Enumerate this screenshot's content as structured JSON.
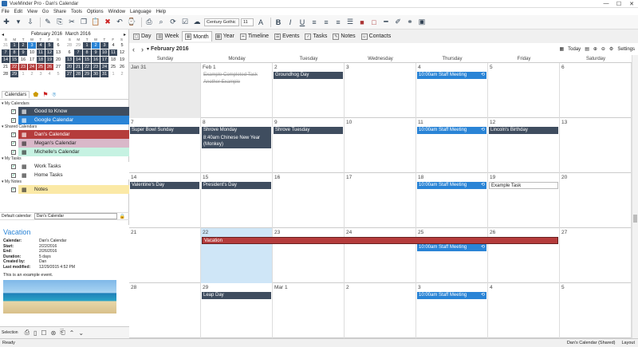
{
  "window": {
    "title": "VueMinder Pro - Dan's Calendar",
    "min": "—",
    "max": "☐",
    "close": "✕"
  },
  "menu": [
    "File",
    "Edit",
    "View",
    "Go",
    "Share",
    "Tools",
    "Options",
    "Window",
    "Language",
    "Help"
  ],
  "toolbar": {
    "font": "Century Gothic",
    "size": "11"
  },
  "mini_calendars": [
    {
      "month": "February 2016",
      "prev": "◂",
      "dow": [
        "S",
        "M",
        "T",
        "W",
        "T",
        "F",
        "S"
      ],
      "days": [
        {
          "n": "31",
          "s": "gr"
        },
        {
          "n": "1",
          "s": "dk"
        },
        {
          "n": "2",
          "s": "dk"
        },
        {
          "n": "3",
          "s": "bl"
        },
        {
          "n": "4",
          "s": "dk"
        },
        {
          "n": "5",
          "s": "dk"
        },
        {
          "n": "6",
          "s": ""
        },
        {
          "n": "7",
          "s": "dk"
        },
        {
          "n": "8",
          "s": "dk"
        },
        {
          "n": "9",
          "s": "dk"
        },
        {
          "n": "10",
          "s": ""
        },
        {
          "n": "11",
          "s": "dk"
        },
        {
          "n": "12",
          "s": "dk"
        },
        {
          "n": "13",
          "s": ""
        },
        {
          "n": "14",
          "s": "dk"
        },
        {
          "n": "15",
          "s": "dk"
        },
        {
          "n": "16",
          "s": ""
        },
        {
          "n": "17",
          "s": ""
        },
        {
          "n": "18",
          "s": "dk"
        },
        {
          "n": "19",
          "s": "dk"
        },
        {
          "n": "20",
          "s": ""
        },
        {
          "n": "21",
          "s": ""
        },
        {
          "n": "22",
          "s": "rd"
        },
        {
          "n": "23",
          "s": "rd"
        },
        {
          "n": "24",
          "s": "rd"
        },
        {
          "n": "25",
          "s": "rd"
        },
        {
          "n": "26",
          "s": "rd"
        },
        {
          "n": "27",
          "s": ""
        },
        {
          "n": "28",
          "s": ""
        },
        {
          "n": "29",
          "s": "dk"
        },
        {
          "n": "1",
          "s": "gr"
        },
        {
          "n": "2",
          "s": "gr"
        },
        {
          "n": "3",
          "s": "gr"
        },
        {
          "n": "4",
          "s": "gr"
        },
        {
          "n": "5",
          "s": "gr"
        }
      ]
    },
    {
      "month": "March 2016",
      "next": "▸",
      "dow": [
        "S",
        "M",
        "T",
        "W",
        "T",
        "F",
        "S"
      ],
      "days": [
        {
          "n": "28",
          "s": "gr"
        },
        {
          "n": "29",
          "s": "gr"
        },
        {
          "n": "1",
          "s": "dk"
        },
        {
          "n": "2",
          "s": "bl"
        },
        {
          "n": "3",
          "s": "dk"
        },
        {
          "n": "4",
          "s": ""
        },
        {
          "n": "5",
          "s": ""
        },
        {
          "n": "6",
          "s": ""
        },
        {
          "n": "7",
          "s": "dk"
        },
        {
          "n": "8",
          "s": "dk"
        },
        {
          "n": "9",
          "s": "dk"
        },
        {
          "n": "10",
          "s": "dk"
        },
        {
          "n": "11",
          "s": "dk"
        },
        {
          "n": "12",
          "s": ""
        },
        {
          "n": "13",
          "s": "dk"
        },
        {
          "n": "14",
          "s": "dk"
        },
        {
          "n": "15",
          "s": "dk"
        },
        {
          "n": "16",
          "s": "dk"
        },
        {
          "n": "17",
          "s": "dk"
        },
        {
          "n": "18",
          "s": ""
        },
        {
          "n": "19",
          "s": ""
        },
        {
          "n": "20",
          "s": "dk"
        },
        {
          "n": "21",
          "s": "dk"
        },
        {
          "n": "22",
          "s": "dk"
        },
        {
          "n": "23",
          "s": "dk"
        },
        {
          "n": "24",
          "s": "dk"
        },
        {
          "n": "25",
          "s": ""
        },
        {
          "n": "26",
          "s": ""
        },
        {
          "n": "27",
          "s": "dk"
        },
        {
          "n": "28",
          "s": "dk"
        },
        {
          "n": "29",
          "s": "dk"
        },
        {
          "n": "30",
          "s": "dk"
        },
        {
          "n": "31",
          "s": "dk"
        },
        {
          "n": "1",
          "s": "gr"
        },
        {
          "n": "2",
          "s": "gr"
        }
      ]
    }
  ],
  "left_tabs": {
    "calendars": "Calendars"
  },
  "calendar_groups": [
    {
      "name": "My Calendars",
      "items": [
        {
          "label": "Good to Know",
          "bg": "#3f4d5f",
          "fg": "#ffffff"
        },
        {
          "label": "Google Calendar",
          "bg": "#2a84d6",
          "fg": "#ffffff"
        }
      ]
    },
    {
      "name": "Shared Calendars",
      "items": [
        {
          "label": "Dan's Calendar",
          "bg": "#b53c3c",
          "fg": "#ffffff"
        },
        {
          "label": "Megan's Calendar",
          "bg": "#d9b8c9",
          "fg": "#222222"
        },
        {
          "label": "Michelle's Calendar",
          "bg": "#c6f2e2",
          "fg": "#222222"
        }
      ]
    },
    {
      "name": "My Tasks",
      "items": [
        {
          "label": "Work Tasks",
          "bg": "#ffffff",
          "fg": "#222222"
        },
        {
          "label": "Home Tasks",
          "bg": "#ffffff",
          "fg": "#222222"
        }
      ]
    },
    {
      "name": "My Notes",
      "items": [
        {
          "label": "Notes",
          "bg": "#fbe9a6",
          "fg": "#222222"
        }
      ]
    }
  ],
  "default_calendar": {
    "label": "Default calendar:",
    "value": "Dan's Calendar"
  },
  "detail": {
    "title": "Vacation",
    "fields": [
      {
        "k": "Calendar:",
        "v": "Dan's Calendar"
      },
      {
        "k": "Start:",
        "v": "2/22/2016"
      },
      {
        "k": "End:",
        "v": "2/26/2016"
      },
      {
        "k": "Duration:",
        "v": "5 days"
      },
      {
        "k": "Created by:",
        "v": "Dan"
      },
      {
        "k": "Last modified:",
        "v": "12/29/2015 4:52 PM"
      }
    ],
    "note": "This is an example event."
  },
  "left_bottom": {
    "selection": "Selection"
  },
  "view_tabs": [
    {
      "label": "Day"
    },
    {
      "label": "Week"
    },
    {
      "label": "Month",
      "active": true
    },
    {
      "label": "Year"
    },
    {
      "label": "Timeline"
    },
    {
      "label": "Events"
    },
    {
      "label": "Tasks"
    },
    {
      "label": "Notes"
    },
    {
      "label": "Contacts"
    }
  ],
  "cal_header": {
    "month_title": "February 2016",
    "today": "Today",
    "settings": "Settings"
  },
  "weekdays": [
    "Sunday",
    "Monday",
    "Tuesday",
    "Wednesday",
    "Thursday",
    "Friday",
    "Saturday"
  ],
  "weeks": [
    {
      "days": [
        {
          "n": "Jan 31",
          "gray": true
        },
        {
          "n": "Feb 1"
        },
        {
          "n": "2"
        },
        {
          "n": "3"
        },
        {
          "n": "4"
        },
        {
          "n": "5"
        },
        {
          "n": "6"
        }
      ],
      "events": [
        {
          "col": 1,
          "row": 0,
          "span": 1,
          "label": "Example Completed Task",
          "style": "strike"
        },
        {
          "col": 1,
          "row": 1,
          "span": 1,
          "label": "Another Example",
          "style": "strike"
        },
        {
          "col": 2,
          "row": 0,
          "span": 1,
          "label": "Groundhog Day",
          "style": "dk"
        },
        {
          "col": 4,
          "row": 0,
          "span": 1,
          "label": "10:00am Staff Meeting",
          "style": "bl",
          "repeat": true
        }
      ]
    },
    {
      "days": [
        {
          "n": "7"
        },
        {
          "n": "8"
        },
        {
          "n": "9"
        },
        {
          "n": "10"
        },
        {
          "n": "11"
        },
        {
          "n": "12"
        },
        {
          "n": "13"
        }
      ],
      "events": [
        {
          "col": 0,
          "row": 0,
          "span": 1,
          "label": "Super Bowl Sunday",
          "style": "dk"
        },
        {
          "col": 1,
          "row": 0,
          "span": 1,
          "label": "Shrove Monday",
          "style": "dk"
        },
        {
          "col": 1,
          "row": 1,
          "span": 1,
          "label": "8:40am Chinese New Year (Monkey)",
          "style": "dk",
          "tall": true
        },
        {
          "col": 2,
          "row": 0,
          "span": 1,
          "label": "Shrove Tuesday",
          "style": "dk"
        },
        {
          "col": 4,
          "row": 0,
          "span": 1,
          "label": "10:00am Staff Meeting",
          "style": "bl",
          "repeat": true
        },
        {
          "col": 5,
          "row": 0,
          "span": 1,
          "label": "Lincoln's Birthday",
          "style": "dk"
        }
      ]
    },
    {
      "days": [
        {
          "n": "14"
        },
        {
          "n": "15"
        },
        {
          "n": "16"
        },
        {
          "n": "17"
        },
        {
          "n": "18"
        },
        {
          "n": "19"
        },
        {
          "n": "20"
        }
      ],
      "events": [
        {
          "col": 0,
          "row": 0,
          "span": 1,
          "label": "Valentine's Day",
          "style": "dk"
        },
        {
          "col": 1,
          "row": 0,
          "span": 1,
          "label": "President's Day",
          "style": "dk"
        },
        {
          "col": 4,
          "row": 0,
          "span": 1,
          "label": "10:00am Staff Meeting",
          "style": "bl",
          "repeat": true
        },
        {
          "col": 5,
          "row": 0,
          "span": 1,
          "label": "Example Task",
          "style": "wt"
        }
      ]
    },
    {
      "days": [
        {
          "n": "21"
        },
        {
          "n": "22",
          "today": true
        },
        {
          "n": "23"
        },
        {
          "n": "24"
        },
        {
          "n": "25"
        },
        {
          "n": "26"
        },
        {
          "n": "27"
        }
      ],
      "events": [
        {
          "col": 1,
          "row": 0,
          "span": 5,
          "label": "Vacation",
          "style": "rd"
        },
        {
          "col": 4,
          "row": 1,
          "span": 1,
          "label": "10:00am Staff Meeting",
          "style": "bl",
          "repeat": true
        }
      ]
    },
    {
      "days": [
        {
          "n": "28"
        },
        {
          "n": "29"
        },
        {
          "n": "Mar 1"
        },
        {
          "n": "2"
        },
        {
          "n": "3"
        },
        {
          "n": "4"
        },
        {
          "n": "5"
        }
      ],
      "events": [
        {
          "col": 1,
          "row": 0,
          "span": 1,
          "label": "Leap Day",
          "style": "dk"
        },
        {
          "col": 4,
          "row": 0,
          "span": 1,
          "label": "10:00am Staff Meeting",
          "style": "bl",
          "repeat": true
        }
      ]
    }
  ],
  "status": {
    "left": "Ready",
    "calendar": "Dan's Calendar (Shared)",
    "mode": "Layout"
  }
}
